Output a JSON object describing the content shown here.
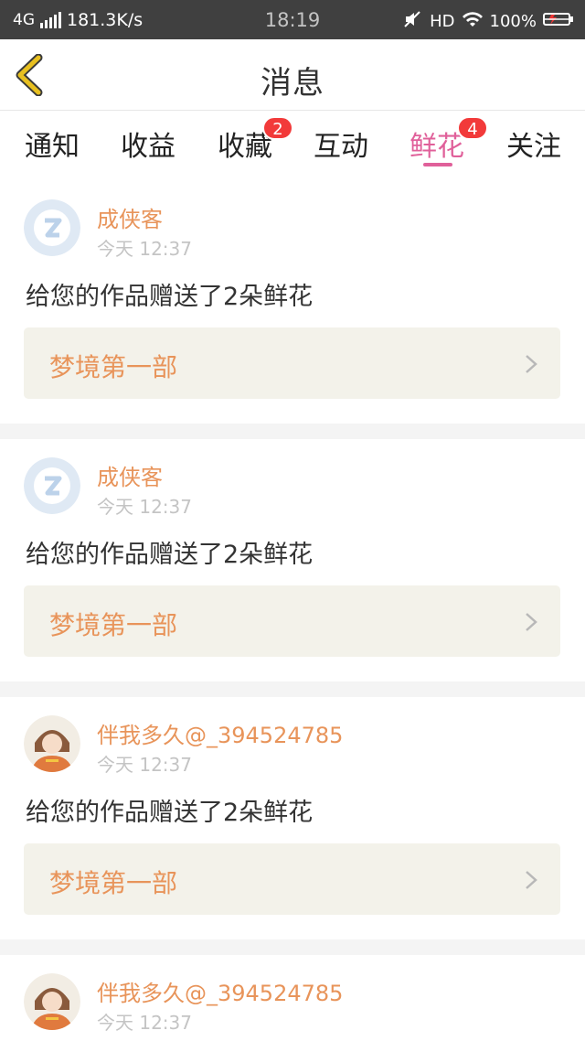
{
  "status_bar": {
    "network": "4G",
    "speed": "181.3K/s",
    "time": "18:19",
    "hd": "HD",
    "battery": "100%",
    "icons": [
      "signal-icon",
      "mute-icon",
      "wifi-icon",
      "battery-icon"
    ]
  },
  "header": {
    "title": "消息",
    "back_icon": "chevron-left-icon",
    "back_color": "#e8c020"
  },
  "tabs": [
    {
      "label": "通知"
    },
    {
      "label": "收益"
    },
    {
      "label": "收藏",
      "badge": "2"
    },
    {
      "label": "互动"
    },
    {
      "label": "鲜花",
      "badge": "4",
      "active": true
    },
    {
      "label": "关注"
    }
  ],
  "colors": {
    "accent": "#e0609a",
    "name": "#e8945a",
    "badge": "#f23a3a",
    "link_bg": "#f3f2ea"
  },
  "messages": [
    {
      "name": "成侠客",
      "time": "今天 12:37",
      "text": "给您的作品赠送了2朵鲜花",
      "work": "梦境第一部",
      "avatar": "qq-avatar-icon"
    },
    {
      "name": "成侠客",
      "time": "今天 12:37",
      "text": "给您的作品赠送了2朵鲜花",
      "work": "梦境第一部",
      "avatar": "qq-avatar-icon"
    },
    {
      "name": "伴我多久@_394524785",
      "time": "今天 12:37",
      "text": "给您的作品赠送了2朵鲜花",
      "work": "梦境第一部",
      "avatar": "user-photo-avatar"
    },
    {
      "name": "伴我多久@_394524785",
      "time": "今天 12:37",
      "avatar": "user-photo-avatar"
    }
  ]
}
